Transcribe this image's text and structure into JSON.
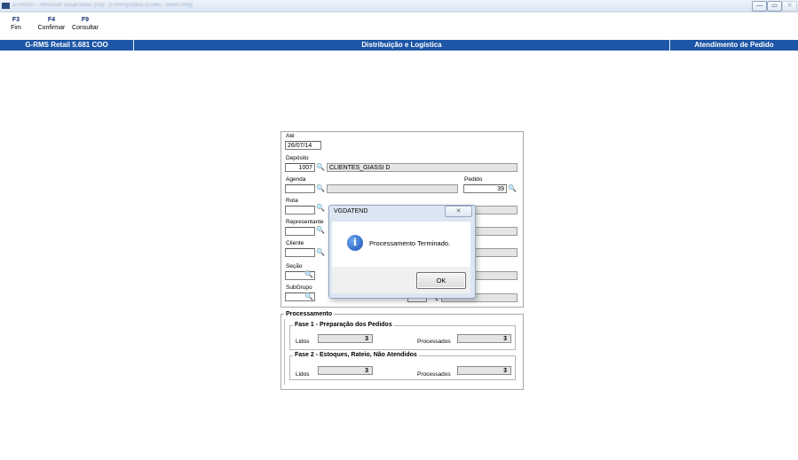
{
  "window": {
    "blurred_title": "DTRDIST - Microsoft Visual Basic [run] - [FrmPrgStatus (Code) - Read Only]",
    "controls": {
      "minimize": "—",
      "restore": "▭",
      "close": "✕"
    }
  },
  "function_keys": [
    {
      "key": "F3",
      "label": "Fim"
    },
    {
      "key": "F4",
      "label": "Confirmar"
    },
    {
      "key": "F9",
      "label": "Consultar"
    }
  ],
  "header": {
    "left": "G-RMS Retail 5.681 COO",
    "center": "Distribuição e Logística",
    "right": "Atendimento de Pedido"
  },
  "form": {
    "ate_label": "Até",
    "ate_value": "26/07/14",
    "deposito_label": "Depósito",
    "deposito_code": "1007",
    "deposito_name": "CLIENTES_GIASSI D",
    "agenda_label": "Agenda",
    "agenda_code": "",
    "agenda_name": "",
    "pedido_label": "Pedido",
    "pedido_value": "39",
    "rota_label": "Rota",
    "representante_label": "Representante",
    "cliente_label": "Cliente",
    "secao_label": "Seção",
    "subgrupo_label": "SubGrupo"
  },
  "processamento": {
    "title": "Processamento",
    "fase1": {
      "title": "Fase 1 - Preparação dos Pedidos",
      "lidos_label": "Lidos",
      "lidos_value": "3",
      "processados_label": "Processados",
      "processados_value": "3"
    },
    "fase2": {
      "title": "Fase 2 - Estoques, Rateio, Não Atendidos",
      "lidos_label": "Lidos",
      "lidos_value": "3",
      "processados_label": "Processados",
      "processados_value": "3"
    }
  },
  "dialog": {
    "title": "VGDATEND",
    "close": "✕",
    "icon": "info-icon",
    "message": "Processamento Terminado.",
    "ok_label": "OK"
  },
  "icons": {
    "binoculars": "🔍"
  },
  "colors": {
    "header_bar": "#1d56a6",
    "function_key": "#0c2c74",
    "dialog_frame": "#dce6f2"
  }
}
